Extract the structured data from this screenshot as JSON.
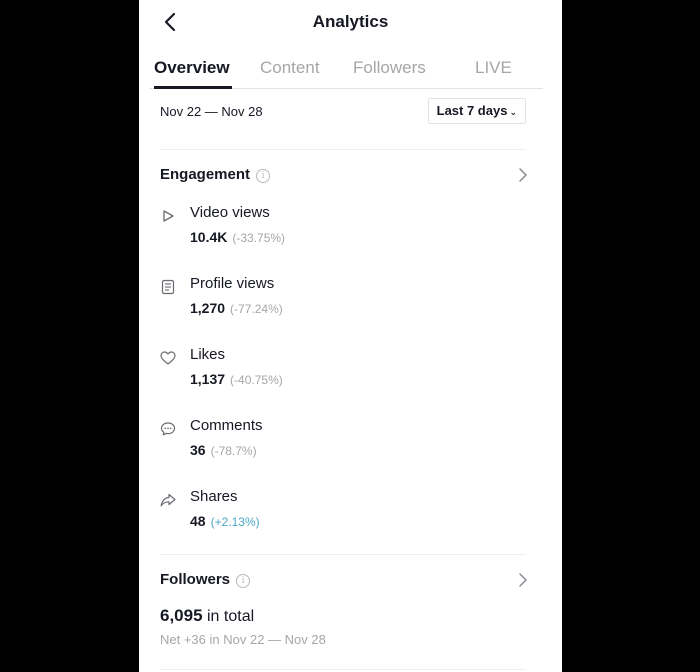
{
  "header": {
    "title": "Analytics",
    "back_icon": "chevron-left-icon"
  },
  "tabs": [
    {
      "label": "Overview",
      "active": true
    },
    {
      "label": "Content",
      "active": false
    },
    {
      "label": "Followers",
      "active": false
    },
    {
      "label": "LIVE",
      "active": false
    }
  ],
  "date_filter": {
    "range": "Nov 22 — Nov 28",
    "selected": "Last 7 days"
  },
  "engagement": {
    "title": "Engagement",
    "metrics": [
      {
        "icon": "play-icon",
        "label": "Video views",
        "value": "10.4K",
        "change": "(-33.75%)",
        "trend": "down"
      },
      {
        "icon": "profile-doc-icon",
        "label": "Profile views",
        "value": "1,270",
        "change": "(-77.24%)",
        "trend": "down"
      },
      {
        "icon": "heart-icon",
        "label": "Likes",
        "value": "1,137",
        "change": "(-40.75%)",
        "trend": "down"
      },
      {
        "icon": "comment-icon",
        "label": "Comments",
        "value": "36",
        "change": "(-78.7%)",
        "trend": "down"
      },
      {
        "icon": "share-icon",
        "label": "Shares",
        "value": "48",
        "change": "(+2.13%)",
        "trend": "up"
      }
    ]
  },
  "followers": {
    "title": "Followers",
    "total": "6,095",
    "total_suffix": "in total",
    "net": "Net +36 in Nov 22 — Nov 28"
  },
  "colors": {
    "text": "#161823",
    "muted": "#a6a6aa",
    "positive": "#4aa7c9"
  }
}
